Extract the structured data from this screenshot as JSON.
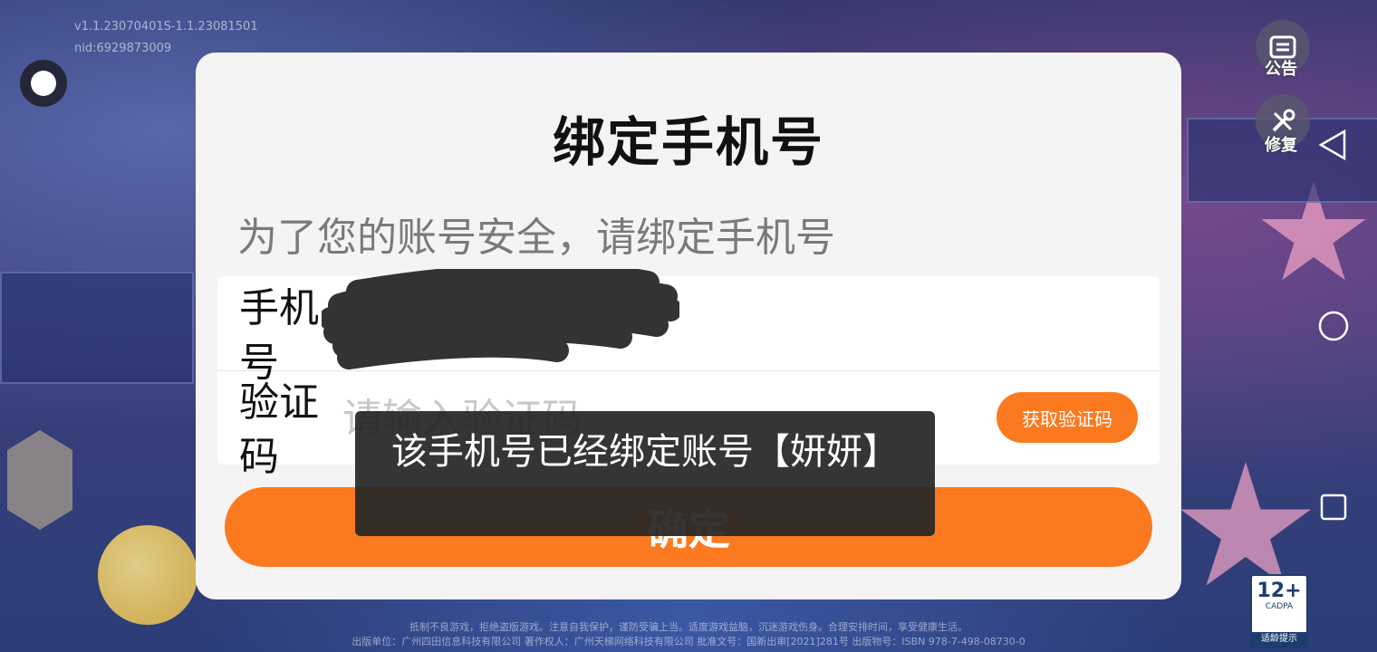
{
  "version": {
    "line1": "v1.1.23070401S-1.1.23081501",
    "line2": "nid:6929873009"
  },
  "side_buttons": {
    "notice_label": "公告",
    "repair_label": "修复"
  },
  "dialog": {
    "title": "绑定手机号",
    "subtitle": "为了您的账号安全，请绑定手机号",
    "phone_label": "手机号",
    "phone_value": "",
    "code_label": "验证码",
    "code_placeholder": "请输入验证码",
    "get_code_label": "获取验证码",
    "confirm_label": "确定"
  },
  "toast": {
    "message": "该手机号已经绑定账号【妍妍】"
  },
  "footer": {
    "line1": "抵制不良游戏，拒绝盗版游戏。注意自我保护，谨防受骗上当。适度游戏益脑，沉迷游戏伤身。合理安排时间，享受健康生活。",
    "line2": "出版单位：广州四田信息科技有限公司  著作权人：广州天梯网络科技有限公司  批准文号：国新出审[2021]281号  出版物号：ISBN 978-7-498-08730-0"
  },
  "age_rating": {
    "num": "12+",
    "org": "CADPA",
    "tip": "适龄提示"
  },
  "colors": {
    "accent": "#fb7a20",
    "dialog_bg": "#f4f4f4",
    "toast_bg": "#262626"
  },
  "icons": [
    "float-ball-icon",
    "notice-icon",
    "repair-icon",
    "nav-back-icon",
    "nav-home-icon",
    "nav-recent-icon"
  ]
}
